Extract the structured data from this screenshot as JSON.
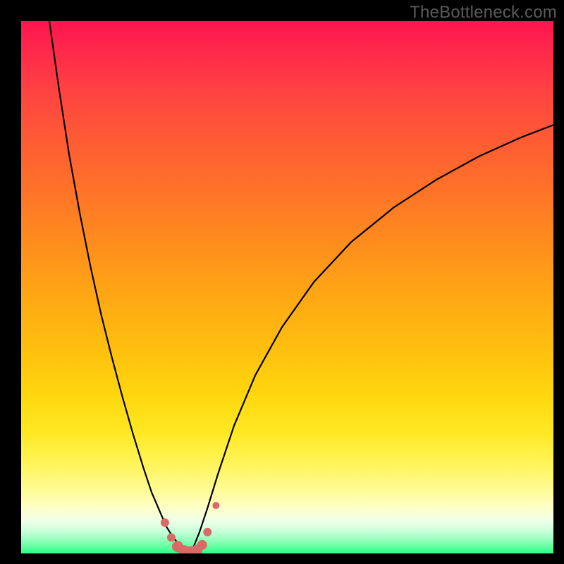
{
  "watermark": "TheBottleneck.com",
  "chart_data": {
    "type": "line",
    "title": "",
    "xlabel": "",
    "ylabel": "",
    "xlim": [
      0,
      100
    ],
    "ylim": [
      0,
      100
    ],
    "series": [
      {
        "name": "left-curve",
        "x": [
          5.3,
          7,
          9,
          11,
          13,
          15,
          17,
          19,
          21,
          23,
          24.5,
          26,
          27.3,
          28.7,
          30.2,
          31.7
        ],
        "y": [
          100,
          88,
          75,
          64,
          54,
          45,
          37,
          29.5,
          22.5,
          16,
          11.5,
          8,
          5,
          2.8,
          1.2,
          0.3
        ]
      },
      {
        "name": "right-curve",
        "x": [
          31.7,
          32.5,
          33.5,
          35,
          37,
          40,
          44,
          49,
          55,
          62,
          70,
          78,
          86,
          94,
          100
        ],
        "y": [
          0.3,
          1.5,
          4,
          8.5,
          15,
          24,
          33.5,
          42.5,
          51,
          58.5,
          65,
          70.2,
          74.6,
          78.2,
          80.5
        ]
      }
    ],
    "markers": {
      "name": "bottom-dots",
      "color": "#d96b65",
      "points": [
        {
          "x": 27.0,
          "y": 5.8,
          "r": 6
        },
        {
          "x": 28.2,
          "y": 3.0,
          "r": 6
        },
        {
          "x": 29.4,
          "y": 1.3,
          "r": 8
        },
        {
          "x": 30.6,
          "y": 0.5,
          "r": 8
        },
        {
          "x": 31.8,
          "y": 0.3,
          "r": 8
        },
        {
          "x": 33.0,
          "y": 0.6,
          "r": 8
        },
        {
          "x": 34.0,
          "y": 1.6,
          "r": 7
        },
        {
          "x": 35.0,
          "y": 4.0,
          "r": 6
        },
        {
          "x": 36.6,
          "y": 9.0,
          "r": 5
        }
      ]
    },
    "background_gradient": {
      "top": "#ff1450",
      "bottom": "#2bff86"
    }
  }
}
